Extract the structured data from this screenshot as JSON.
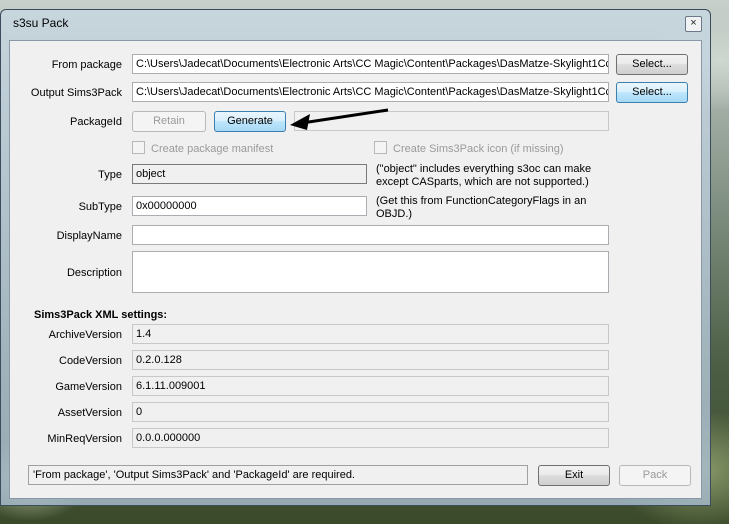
{
  "window": {
    "title": "s3su Pack",
    "close_glyph": "×"
  },
  "form": {
    "from_package": {
      "label": "From package",
      "value": "C:\\Users\\Jadecat\\Documents\\Electronic Arts\\CC Magic\\Content\\Packages\\DasMatze-Skylight1Cc",
      "button": "Select..."
    },
    "output": {
      "label": "Output Sims3Pack",
      "value": "C:\\Users\\Jadecat\\Documents\\Electronic Arts\\CC Magic\\Content\\Packages\\DasMatze-Skylight1Cc",
      "button": "Select..."
    },
    "package_id": {
      "label": "PackageId",
      "retain": "Retain",
      "generate": "Generate",
      "value": ""
    },
    "checks": {
      "manifest": "Create package manifest",
      "icon": "Create Sims3Pack icon (if missing)"
    },
    "type": {
      "label": "Type",
      "value": "object",
      "note": "(\"object\" includes everything s3oc can make except CASparts, which are not supported.)"
    },
    "subtype": {
      "label": "SubType",
      "value": "0x00000000",
      "note": "(Get this from FunctionCategoryFlags in an OBJD.)"
    },
    "display_name": {
      "label": "DisplayName",
      "value": ""
    },
    "description": {
      "label": "Description",
      "value": ""
    }
  },
  "xml": {
    "heading": "Sims3Pack XML settings:",
    "archive_version": {
      "label": "ArchiveVersion",
      "value": "1.4"
    },
    "code_version": {
      "label": "CodeVersion",
      "value": "0.2.0.128"
    },
    "game_version": {
      "label": "GameVersion",
      "value": "6.1.11.009001"
    },
    "asset_version": {
      "label": "AssetVersion",
      "value": "0"
    },
    "min_req_version": {
      "label": "MinReqVersion",
      "value": "0.0.0.000000"
    }
  },
  "footer": {
    "status": "'From package', 'Output Sims3Pack' and 'PackageId' are required.",
    "exit": "Exit",
    "pack": "Pack"
  }
}
